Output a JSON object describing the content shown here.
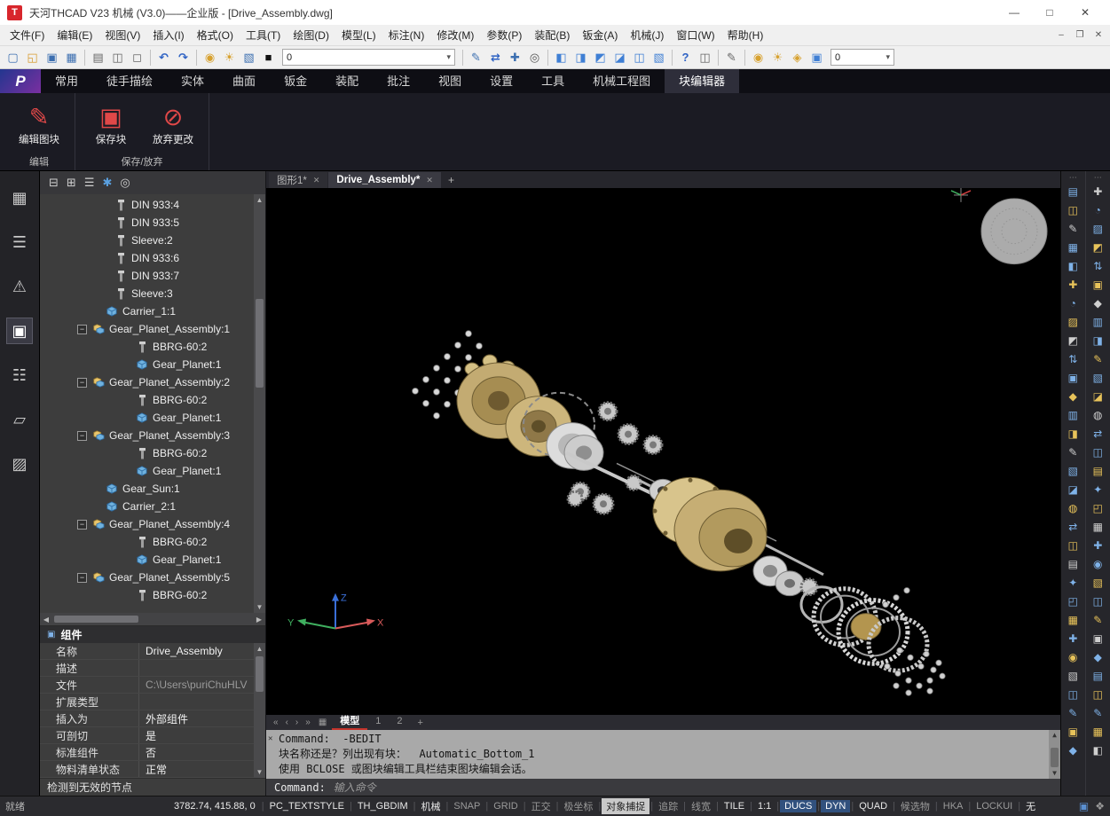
{
  "window": {
    "title": "天河THCAD V23 机械 (V3.0)——企业版 - [Drive_Assembly.dwg]",
    "app_initial": "T"
  },
  "menu_bar": {
    "items": [
      "文件(F)",
      "编辑(E)",
      "视图(V)",
      "插入(I)",
      "格式(O)",
      "工具(T)",
      "绘图(D)",
      "模型(L)",
      "标注(N)",
      "修改(M)",
      "参数(P)",
      "装配(B)",
      "钣金(A)",
      "机械(J)",
      "窗口(W)",
      "帮助(H)"
    ]
  },
  "toolbar": {
    "items": [
      {
        "t": "i",
        "n": "new-file-icon"
      },
      {
        "t": "i",
        "n": "open-file-icon"
      },
      {
        "t": "i",
        "n": "save-icon"
      },
      {
        "t": "i",
        "n": "save-all-icon"
      },
      {
        "t": "s"
      },
      {
        "t": "i",
        "n": "plot-settings-icon"
      },
      {
        "t": "i",
        "n": "print-icon"
      },
      {
        "t": "i",
        "n": "print-preview-icon"
      },
      {
        "t": "s"
      },
      {
        "t": "i",
        "n": "undo-icon"
      },
      {
        "t": "i",
        "n": "redo-icon"
      },
      {
        "t": "s"
      },
      {
        "t": "i",
        "n": "layer-on-icon"
      },
      {
        "t": "i",
        "n": "layer-freeze-icon"
      },
      {
        "t": "i",
        "n": "layer-properties-icon"
      },
      {
        "t": "i",
        "n": "color-swatch-icon"
      },
      {
        "t": "c",
        "n": "layer-combo",
        "v": "0",
        "w": true
      },
      {
        "t": "s"
      },
      {
        "t": "i",
        "n": "match-properties-icon"
      },
      {
        "t": "i",
        "n": "sync-icon"
      },
      {
        "t": "i",
        "n": "edit-attributes-icon"
      },
      {
        "t": "i",
        "n": "find-icon"
      },
      {
        "t": "s"
      },
      {
        "t": "i",
        "n": "view-wireframe-icon"
      },
      {
        "t": "i",
        "n": "view-hidden-icon"
      },
      {
        "t": "i",
        "n": "view-shaded-icon"
      },
      {
        "t": "i",
        "n": "view-realistic-icon"
      },
      {
        "t": "i",
        "n": "view-iso-icon"
      },
      {
        "t": "i",
        "n": "view-manager-icon"
      },
      {
        "t": "s"
      },
      {
        "t": "i",
        "n": "help-icon"
      },
      {
        "t": "i",
        "n": "print2-icon"
      },
      {
        "t": "s"
      },
      {
        "t": "i",
        "n": "pencil-icon"
      },
      {
        "t": "s"
      },
      {
        "t": "i",
        "n": "bulb-icon"
      },
      {
        "t": "i",
        "n": "brightness-icon"
      },
      {
        "t": "i",
        "n": "lock-icon"
      },
      {
        "t": "i",
        "n": "box-icon"
      },
      {
        "t": "c",
        "n": "linetype-combo",
        "v": "0",
        "w": false
      }
    ]
  },
  "ribbon": {
    "tabs": [
      {
        "label": "常用"
      },
      {
        "label": "徒手描绘"
      },
      {
        "label": "实体"
      },
      {
        "label": "曲面"
      },
      {
        "label": "钣金"
      },
      {
        "label": "装配"
      },
      {
        "label": "批注"
      },
      {
        "label": "视图"
      },
      {
        "label": "设置"
      },
      {
        "label": "工具"
      },
      {
        "label": "机械工程图"
      },
      {
        "label": "块编辑器",
        "active": true
      }
    ],
    "groups": [
      {
        "label": "编辑",
        "buttons": [
          {
            "label": "编辑图块",
            "icon": "edit-block-icon"
          }
        ]
      },
      {
        "label": "保存/放弃",
        "buttons": [
          {
            "label": "保存块",
            "icon": "save-block-icon"
          },
          {
            "label": "放弃更改",
            "icon": "discard-changes-icon"
          }
        ]
      }
    ]
  },
  "left_rail": {
    "icons": [
      {
        "name": "table-icon"
      },
      {
        "name": "sliders-icon"
      },
      {
        "name": "warning-icon"
      },
      {
        "name": "component-box-icon",
        "active": true
      },
      {
        "name": "structure-icon"
      },
      {
        "name": "tag-icon"
      },
      {
        "name": "hatch-icon"
      }
    ]
  },
  "browser_panel": {
    "mini_toolbar": [
      "collapse-all-icon",
      "expand-all-icon",
      "list-view-icon",
      "settings-gear-icon",
      "search-icon"
    ],
    "tree": [
      {
        "label": "DIN 933:4",
        "icon": "bolt",
        "depth": 2
      },
      {
        "label": "DIN 933:5",
        "icon": "bolt",
        "depth": 2
      },
      {
        "label": "Sleeve:2",
        "icon": "bolt",
        "depth": 2
      },
      {
        "label": "DIN 933:6",
        "icon": "bolt",
        "depth": 2
      },
      {
        "label": "DIN 933:7",
        "icon": "bolt",
        "depth": 2
      },
      {
        "label": "Sleeve:3",
        "icon": "bolt",
        "depth": 2
      },
      {
        "label": "Carrier_1:1",
        "icon": "part",
        "depth": 1
      },
      {
        "label": "Gear_Planet_Assembly:1",
        "icon": "assembly",
        "depth": 0,
        "expander": true
      },
      {
        "label": "BBRG-60:2",
        "icon": "bolt",
        "depth": 3
      },
      {
        "label": "Gear_Planet:1",
        "icon": "part",
        "depth": 3
      },
      {
        "label": "Gear_Planet_Assembly:2",
        "icon": "assembly",
        "depth": 0,
        "expander": true
      },
      {
        "label": "BBRG-60:2",
        "icon": "bolt",
        "depth": 3
      },
      {
        "label": "Gear_Planet:1",
        "icon": "part",
        "depth": 3
      },
      {
        "label": "Gear_Planet_Assembly:3",
        "icon": "assembly",
        "depth": 0,
        "expander": true
      },
      {
        "label": "BBRG-60:2",
        "icon": "bolt",
        "depth": 3
      },
      {
        "label": "Gear_Planet:1",
        "icon": "part",
        "depth": 3
      },
      {
        "label": "Gear_Sun:1",
        "icon": "part",
        "depth": 1
      },
      {
        "label": "Carrier_2:1",
        "icon": "part",
        "depth": 1
      },
      {
        "label": "Gear_Planet_Assembly:4",
        "icon": "assembly",
        "depth": 0,
        "expander": true
      },
      {
        "label": "BBRG-60:2",
        "icon": "bolt",
        "depth": 3
      },
      {
        "label": "Gear_Planet:1",
        "icon": "part",
        "depth": 3
      },
      {
        "label": "Gear_Planet_Assembly:5",
        "icon": "assembly",
        "depth": 0,
        "expander": true
      },
      {
        "label": "BBRG-60:2",
        "icon": "bolt",
        "depth": 3
      }
    ],
    "properties": {
      "header": "组件",
      "rows": [
        {
          "label": "名称",
          "value": "Drive_Assembly"
        },
        {
          "label": "描述",
          "value": ""
        },
        {
          "label": "文件",
          "value": "C:\\Users\\puriChuHLV",
          "muted": true
        },
        {
          "label": "扩展类型",
          "value": ""
        },
        {
          "label": "插入为",
          "value": "外部组件"
        },
        {
          "label": "可剖切",
          "value": "是"
        },
        {
          "label": "标准组件",
          "value": "否"
        },
        {
          "label": "物料清单状态",
          "value": "正常"
        }
      ]
    },
    "status": "检测到无效的节点"
  },
  "doc_tabs": {
    "tabs": [
      {
        "label": "图形1*"
      },
      {
        "label": "Drive_Assembly*",
        "active": true
      }
    ]
  },
  "layout_tabs": {
    "tabs": [
      "模型",
      "1",
      "2"
    ],
    "active": "模型"
  },
  "command": {
    "history": [
      "Command:  -BEDIT",
      "块名称还是？列出现有块：  Automatic_Bottom_1",
      "使用 BCLOSE 或图块编辑工具栏结束图块编辑会话。"
    ],
    "prompt": "Command:",
    "placeholder": "输入命令"
  },
  "status_bar": {
    "ready": "就绪",
    "coords": "3782.74, 415.88, 0",
    "items": [
      {
        "label": "PC_TEXTSTYLE",
        "state": "bright"
      },
      {
        "label": "TH_GBDIM",
        "state": "bright"
      },
      {
        "label": "机械",
        "state": "bright"
      },
      {
        "label": "SNAP",
        "state": "dim"
      },
      {
        "label": "GRID",
        "state": "dim"
      },
      {
        "label": "正交",
        "state": "dim"
      },
      {
        "label": "极坐标",
        "state": "dim"
      },
      {
        "label": "对象捕捉",
        "state": "active-light"
      },
      {
        "label": "追踪",
        "state": "dim"
      },
      {
        "label": "线宽",
        "state": "dim"
      },
      {
        "label": "TILE",
        "state": "bright"
      },
      {
        "label": "1:1",
        "state": "bright"
      },
      {
        "label": "DUCS",
        "state": "active-blue"
      },
      {
        "label": "DYN",
        "state": "active-blue"
      },
      {
        "label": "QUAD",
        "state": "bright"
      },
      {
        "label": "候选物",
        "state": "dim"
      },
      {
        "label": "HKA",
        "state": "dim"
      },
      {
        "label": "LOCKUI",
        "state": "dim"
      },
      {
        "label": "无",
        "state": "bright"
      }
    ]
  },
  "right_rails": {
    "column_a_icons": 31,
    "column_b_icons": 31
  },
  "colors": {
    "accent_red": "#e04848",
    "ribbon_bg": "#1b1b23",
    "panel_bg": "#3d3d3d",
    "viewport_bg": "#000000",
    "highlight_blue": "#31517e"
  }
}
